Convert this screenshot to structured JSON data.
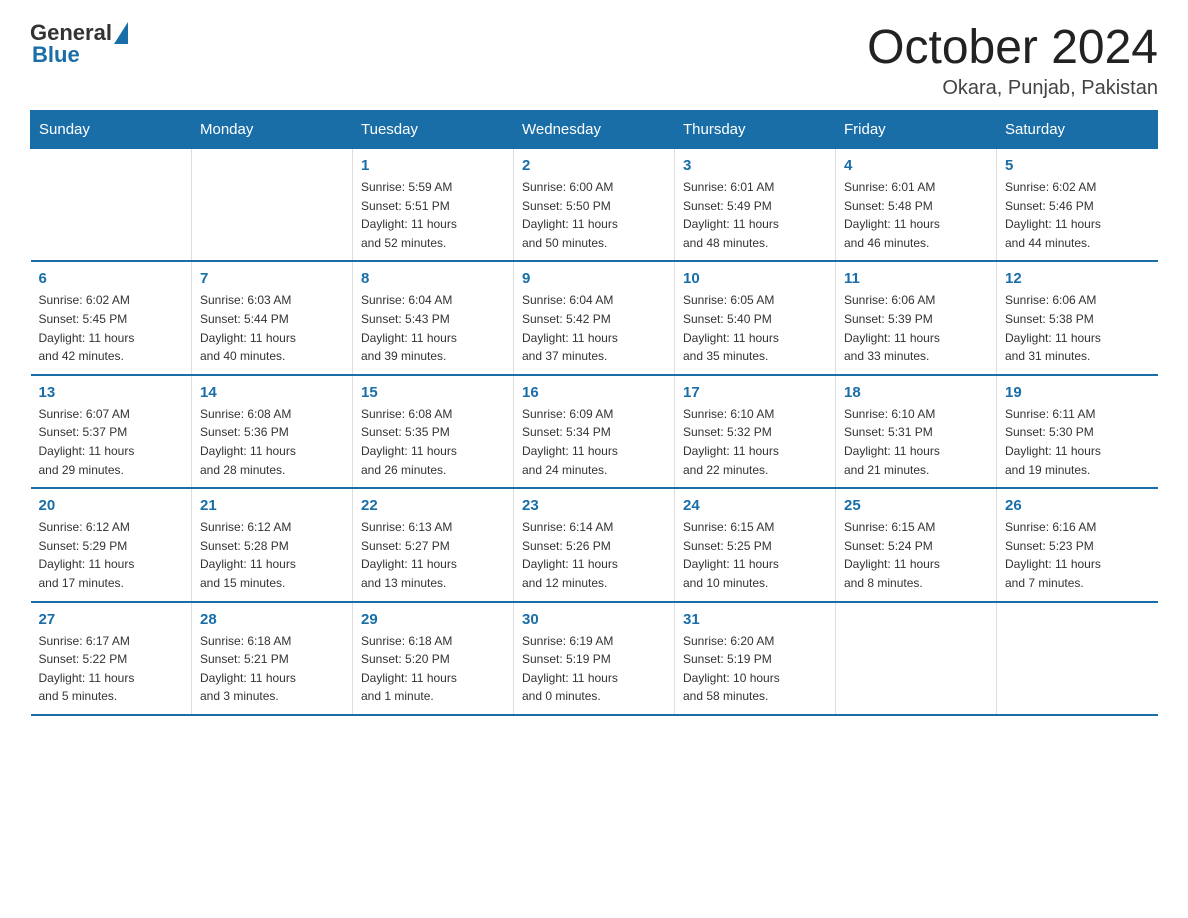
{
  "header": {
    "title": "October 2024",
    "location": "Okara, Punjab, Pakistan",
    "logo_general": "General",
    "logo_blue": "Blue"
  },
  "days_of_week": [
    "Sunday",
    "Monday",
    "Tuesday",
    "Wednesday",
    "Thursday",
    "Friday",
    "Saturday"
  ],
  "weeks": [
    [
      {
        "day": "",
        "info": ""
      },
      {
        "day": "",
        "info": ""
      },
      {
        "day": "1",
        "info": "Sunrise: 5:59 AM\nSunset: 5:51 PM\nDaylight: 11 hours\nand 52 minutes."
      },
      {
        "day": "2",
        "info": "Sunrise: 6:00 AM\nSunset: 5:50 PM\nDaylight: 11 hours\nand 50 minutes."
      },
      {
        "day": "3",
        "info": "Sunrise: 6:01 AM\nSunset: 5:49 PM\nDaylight: 11 hours\nand 48 minutes."
      },
      {
        "day": "4",
        "info": "Sunrise: 6:01 AM\nSunset: 5:48 PM\nDaylight: 11 hours\nand 46 minutes."
      },
      {
        "day": "5",
        "info": "Sunrise: 6:02 AM\nSunset: 5:46 PM\nDaylight: 11 hours\nand 44 minutes."
      }
    ],
    [
      {
        "day": "6",
        "info": "Sunrise: 6:02 AM\nSunset: 5:45 PM\nDaylight: 11 hours\nand 42 minutes."
      },
      {
        "day": "7",
        "info": "Sunrise: 6:03 AM\nSunset: 5:44 PM\nDaylight: 11 hours\nand 40 minutes."
      },
      {
        "day": "8",
        "info": "Sunrise: 6:04 AM\nSunset: 5:43 PM\nDaylight: 11 hours\nand 39 minutes."
      },
      {
        "day": "9",
        "info": "Sunrise: 6:04 AM\nSunset: 5:42 PM\nDaylight: 11 hours\nand 37 minutes."
      },
      {
        "day": "10",
        "info": "Sunrise: 6:05 AM\nSunset: 5:40 PM\nDaylight: 11 hours\nand 35 minutes."
      },
      {
        "day": "11",
        "info": "Sunrise: 6:06 AM\nSunset: 5:39 PM\nDaylight: 11 hours\nand 33 minutes."
      },
      {
        "day": "12",
        "info": "Sunrise: 6:06 AM\nSunset: 5:38 PM\nDaylight: 11 hours\nand 31 minutes."
      }
    ],
    [
      {
        "day": "13",
        "info": "Sunrise: 6:07 AM\nSunset: 5:37 PM\nDaylight: 11 hours\nand 29 minutes."
      },
      {
        "day": "14",
        "info": "Sunrise: 6:08 AM\nSunset: 5:36 PM\nDaylight: 11 hours\nand 28 minutes."
      },
      {
        "day": "15",
        "info": "Sunrise: 6:08 AM\nSunset: 5:35 PM\nDaylight: 11 hours\nand 26 minutes."
      },
      {
        "day": "16",
        "info": "Sunrise: 6:09 AM\nSunset: 5:34 PM\nDaylight: 11 hours\nand 24 minutes."
      },
      {
        "day": "17",
        "info": "Sunrise: 6:10 AM\nSunset: 5:32 PM\nDaylight: 11 hours\nand 22 minutes."
      },
      {
        "day": "18",
        "info": "Sunrise: 6:10 AM\nSunset: 5:31 PM\nDaylight: 11 hours\nand 21 minutes."
      },
      {
        "day": "19",
        "info": "Sunrise: 6:11 AM\nSunset: 5:30 PM\nDaylight: 11 hours\nand 19 minutes."
      }
    ],
    [
      {
        "day": "20",
        "info": "Sunrise: 6:12 AM\nSunset: 5:29 PM\nDaylight: 11 hours\nand 17 minutes."
      },
      {
        "day": "21",
        "info": "Sunrise: 6:12 AM\nSunset: 5:28 PM\nDaylight: 11 hours\nand 15 minutes."
      },
      {
        "day": "22",
        "info": "Sunrise: 6:13 AM\nSunset: 5:27 PM\nDaylight: 11 hours\nand 13 minutes."
      },
      {
        "day": "23",
        "info": "Sunrise: 6:14 AM\nSunset: 5:26 PM\nDaylight: 11 hours\nand 12 minutes."
      },
      {
        "day": "24",
        "info": "Sunrise: 6:15 AM\nSunset: 5:25 PM\nDaylight: 11 hours\nand 10 minutes."
      },
      {
        "day": "25",
        "info": "Sunrise: 6:15 AM\nSunset: 5:24 PM\nDaylight: 11 hours\nand 8 minutes."
      },
      {
        "day": "26",
        "info": "Sunrise: 6:16 AM\nSunset: 5:23 PM\nDaylight: 11 hours\nand 7 minutes."
      }
    ],
    [
      {
        "day": "27",
        "info": "Sunrise: 6:17 AM\nSunset: 5:22 PM\nDaylight: 11 hours\nand 5 minutes."
      },
      {
        "day": "28",
        "info": "Sunrise: 6:18 AM\nSunset: 5:21 PM\nDaylight: 11 hours\nand 3 minutes."
      },
      {
        "day": "29",
        "info": "Sunrise: 6:18 AM\nSunset: 5:20 PM\nDaylight: 11 hours\nand 1 minute."
      },
      {
        "day": "30",
        "info": "Sunrise: 6:19 AM\nSunset: 5:19 PM\nDaylight: 11 hours\nand 0 minutes."
      },
      {
        "day": "31",
        "info": "Sunrise: 6:20 AM\nSunset: 5:19 PM\nDaylight: 10 hours\nand 58 minutes."
      },
      {
        "day": "",
        "info": ""
      },
      {
        "day": "",
        "info": ""
      }
    ]
  ]
}
